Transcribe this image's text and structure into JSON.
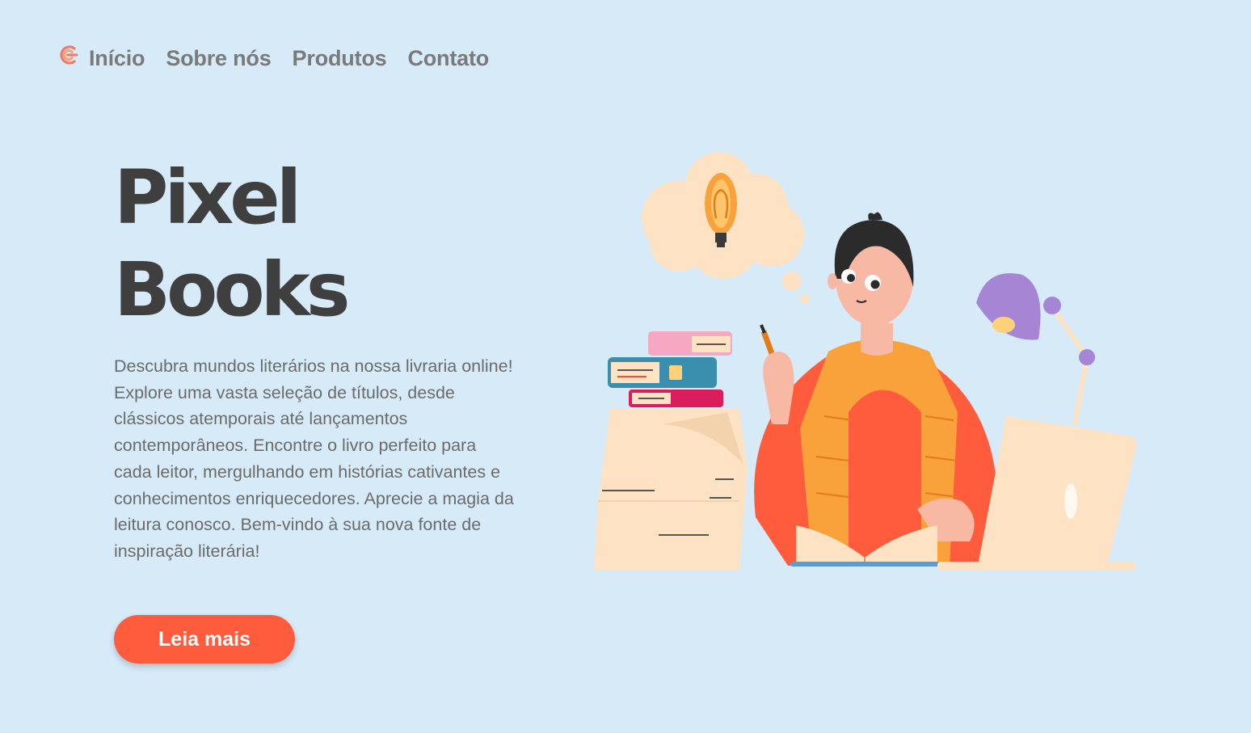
{
  "nav": {
    "logo_icon": "brand-logo-icon",
    "items": [
      {
        "label": "Início"
      },
      {
        "label": "Sobre nós"
      },
      {
        "label": "Produtos"
      },
      {
        "label": "Contato"
      }
    ]
  },
  "hero": {
    "title_line1": "Pixel",
    "title_line2": "Books",
    "description": "Descubra mundos literários na nossa livraria online! Explore uma vasta seleção de títulos, desde clássicos atemporais até lançamentos contemporâneos. Encontre o livro perfeito para cada leitor, mergulhando em histórias cativantes e conhecimentos enriquecedores. Aprecie a magia da leitura conosco. Bem-vindo à sua nova fonte de inspiração literária!",
    "cta_label": "Leia mais"
  },
  "colors": {
    "background": "#d6eaf8",
    "accent": "#ff5b3d",
    "title": "#3f3f3f",
    "text": "#6b6b6b",
    "nav_text": "#7a7a7a"
  }
}
